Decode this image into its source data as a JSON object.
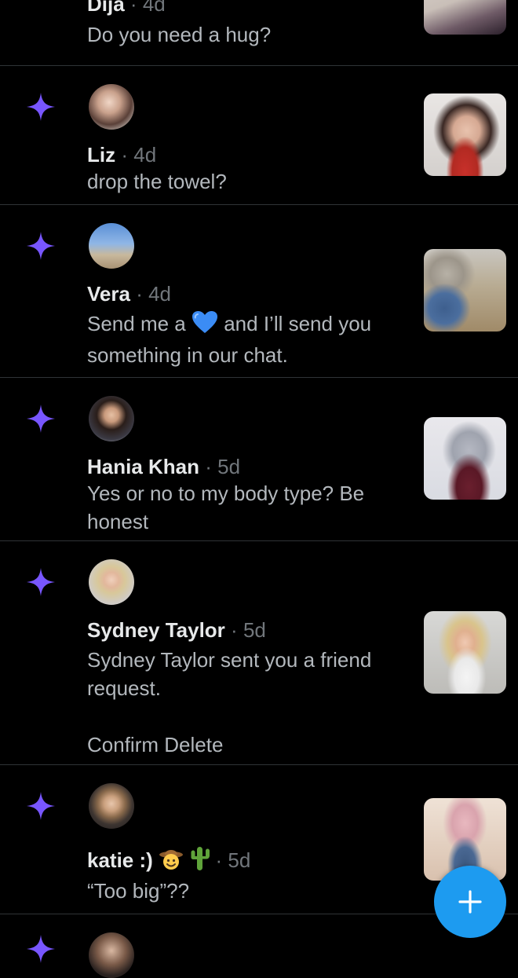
{
  "colors": {
    "accent": "#7856ff",
    "fab": "#1d9bf0",
    "divider": "#2f3336",
    "secondary_text": "#71767b"
  },
  "notifications": [
    {
      "name": "Dija",
      "sep": "·",
      "age": "4d",
      "message": "Do you need a hug?"
    },
    {
      "name": "Liz",
      "sep": "·",
      "age": "4d",
      "message": "drop the towel?"
    },
    {
      "name": "Vera",
      "sep": "·",
      "age": "4d",
      "message_before": "Send me a",
      "message_emoji": "blue-heart",
      "message_after": "and I’ll send you something in our chat."
    },
    {
      "name": "Hania Khan",
      "sep": "·",
      "age": "5d",
      "message": "Yes or no to my body type? Be honest"
    },
    {
      "name": "Sydney Taylor",
      "sep": "·",
      "age": "5d",
      "message": "Sydney Taylor sent you a friend request.",
      "actions": {
        "confirm": "Confirm",
        "delete": "Delete"
      }
    },
    {
      "name": "katie :)",
      "name_emojis": [
        "cowboy-face",
        "cactus"
      ],
      "sep": "·",
      "age": "5d",
      "message": "“Too big”??"
    }
  ],
  "fab": {
    "icon": "plus-icon"
  },
  "icons": {
    "sparkle": "sparkle-icon"
  }
}
